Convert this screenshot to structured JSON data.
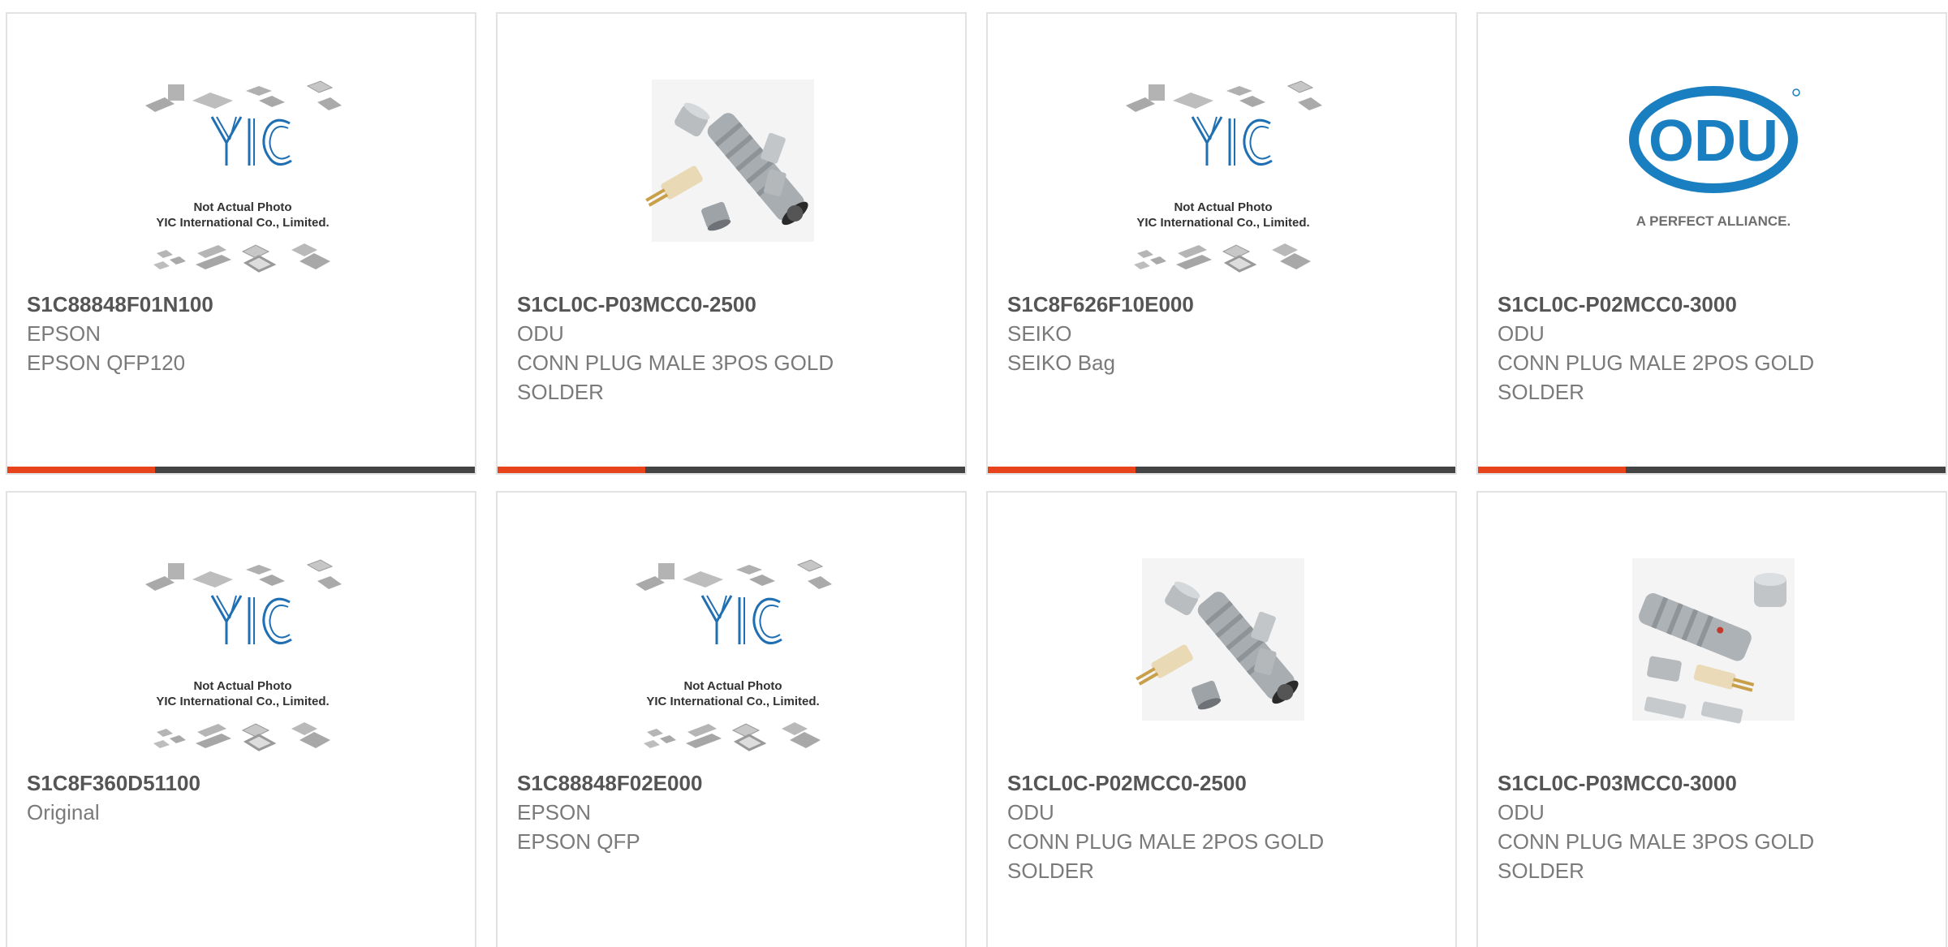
{
  "colors": {
    "accent": "#e8441b",
    "bar": "#444444",
    "border": "#e2e2e2",
    "part_number": "#555555",
    "text": "#7a7a7a",
    "yic_blue": "#1f6fb2",
    "odu_blue": "#1a7fc0"
  },
  "placeholder": {
    "caption_line1": "Not Actual Photo",
    "caption_line2": "YIC International Co., Limited.",
    "logo_text": "YIC"
  },
  "odu_logo": {
    "brand": "ODU",
    "tagline": "A PERFECT ALLIANCE."
  },
  "products": [
    {
      "part_number": "S1C88848F01N100",
      "manufacturer": "EPSON",
      "description": "EPSON QFP120",
      "image": "placeholder-chips-icon"
    },
    {
      "part_number": "S1CL0C-P03MCC0-2500",
      "manufacturer": "ODU",
      "description": "CONN PLUG MALE 3POS GOLD SOLDER",
      "image": "connector-kit-icon"
    },
    {
      "part_number": "S1C8F626F10E000",
      "manufacturer": "SEIKO",
      "description": "SEIKO Bag",
      "image": "placeholder-chips-icon"
    },
    {
      "part_number": "S1CL0C-P02MCC0-3000",
      "manufacturer": "ODU",
      "description": "CONN PLUG MALE 2POS GOLD SOLDER",
      "image": "odu-logo-icon"
    },
    {
      "part_number": "S1C8F360D51100",
      "manufacturer": "Original",
      "description": "",
      "image": "placeholder-chips-icon"
    },
    {
      "part_number": "S1C88848F02E000",
      "manufacturer": "EPSON",
      "description": "EPSON QFP",
      "image": "placeholder-chips-icon"
    },
    {
      "part_number": "S1CL0C-P02MCC0-2500",
      "manufacturer": "ODU",
      "description": "CONN PLUG MALE 2POS GOLD SOLDER",
      "image": "connector-kit-icon"
    },
    {
      "part_number": "S1CL0C-P03MCC0-3000",
      "manufacturer": "ODU",
      "description": "CONN PLUG MALE 3POS GOLD SOLDER",
      "image": "connector-kit-alt-icon"
    }
  ]
}
